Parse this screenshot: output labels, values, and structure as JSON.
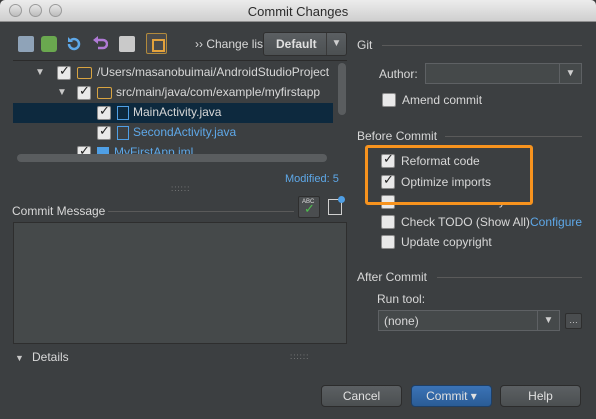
{
  "window": {
    "title": "Commit Changes"
  },
  "toolbar": {
    "changelist_label": "›› Change list:",
    "changelist_value": "Default",
    "icons": [
      "refresh-icon",
      "diff-icon",
      "revert-icon",
      "undo-icon",
      "edit-icon",
      "group-by-directory-icon"
    ]
  },
  "tree": {
    "items": [
      {
        "label": "/Users/masanobuimai/AndroidStudioProject",
        "type": "folder",
        "checked": true
      },
      {
        "label": "src/main/java/com/example/myfirstapp",
        "type": "folder",
        "checked": true
      },
      {
        "label": "MainActivity.java",
        "type": "file",
        "checked": true,
        "selected": true
      },
      {
        "label": "SecondActivity.java",
        "type": "file",
        "checked": true
      },
      {
        "label": "MyFirstApp.iml",
        "type": "module",
        "checked": true
      }
    ],
    "modified": "Modified: 5"
  },
  "commit_message": {
    "label": "Commit Message",
    "value": ""
  },
  "details": {
    "label": "Details"
  },
  "git": {
    "section": "Git",
    "author_label": "Author:",
    "author_value": "",
    "amend_label": "Amend commit"
  },
  "before_commit": {
    "section": "Before Commit",
    "reformat": "Reformat code",
    "optimize": "Optimize imports",
    "analyze": "Perform code analysis",
    "todo": "Check TODO (Show All)",
    "configure": "Configure",
    "copyright": "Update copyright"
  },
  "after_commit": {
    "section": "After Commit",
    "run_tool_label": "Run tool:",
    "run_tool_value": "(none)"
  },
  "buttons": {
    "cancel": "Cancel",
    "commit": "Commit ▾",
    "help": "Help"
  },
  "colors": {
    "accent": "#2a5c96",
    "highlight": "#f7931e",
    "link": "#5ea8e8",
    "selection": "#0d293e"
  }
}
